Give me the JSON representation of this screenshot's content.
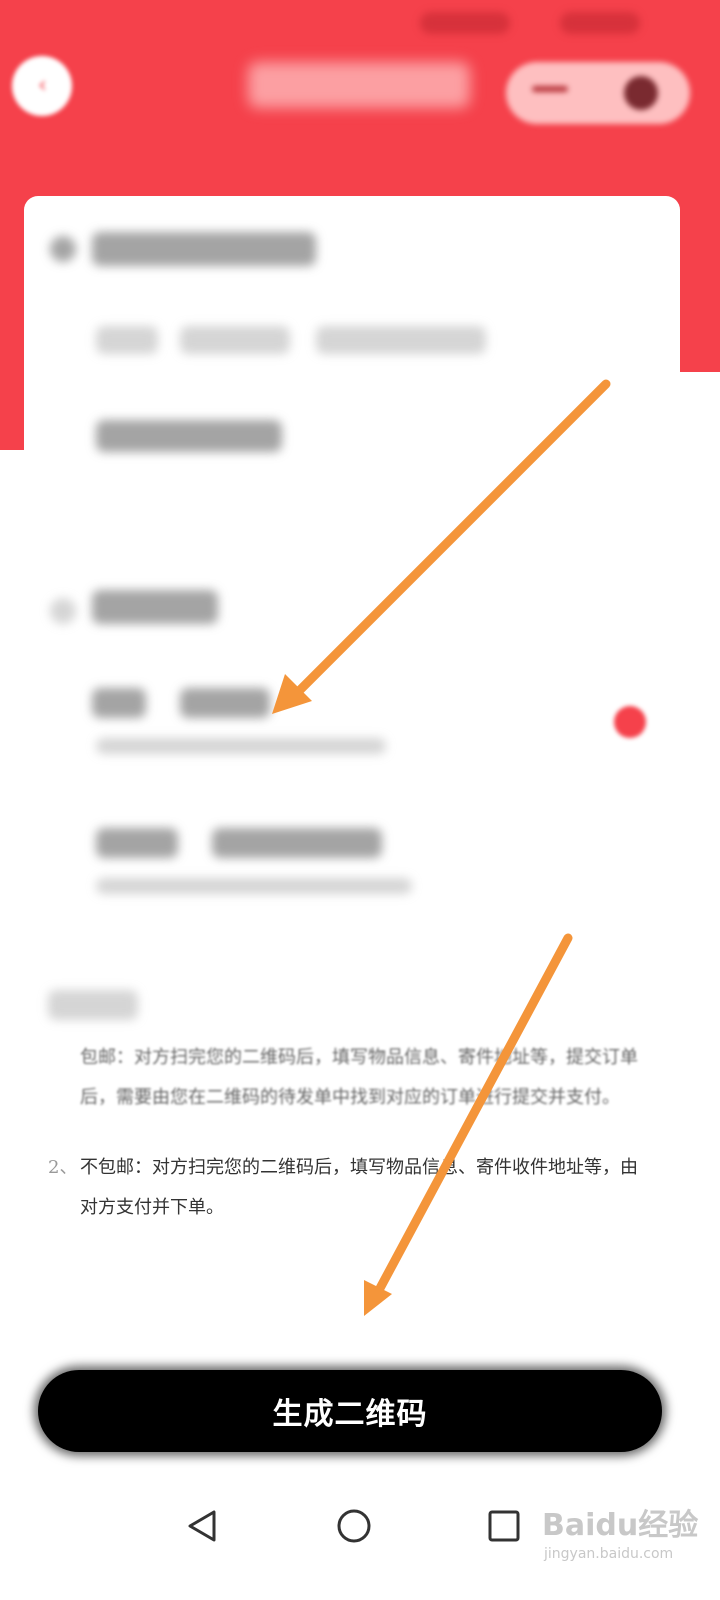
{
  "app": {
    "theme_color": "#f5414b",
    "back_icon": "back-arrow-icon",
    "menu_icons": [
      "more-dots-icon",
      "close-circle-icon"
    ]
  },
  "notes": [
    {
      "number": "",
      "text": "包邮：对方扫完您的二维码后，填写物品信息、寄件地址等，提交订单后，需要由您在二维码的待发单中找到对应的订单进行提交并支付。"
    },
    {
      "number": "2、",
      "text": "不包邮：对方扫完您的二维码后，填写物品信息、寄件收件地址等，由对方支付并下单。"
    }
  ],
  "primary_button": {
    "label": "生成二维码",
    "color": "#000000"
  },
  "nav": {
    "icons": [
      "nav-back-icon",
      "nav-home-icon",
      "nav-recent-icon"
    ]
  },
  "watermark": {
    "logo": "Baidu经验",
    "url": "jingyan.baidu.com"
  }
}
